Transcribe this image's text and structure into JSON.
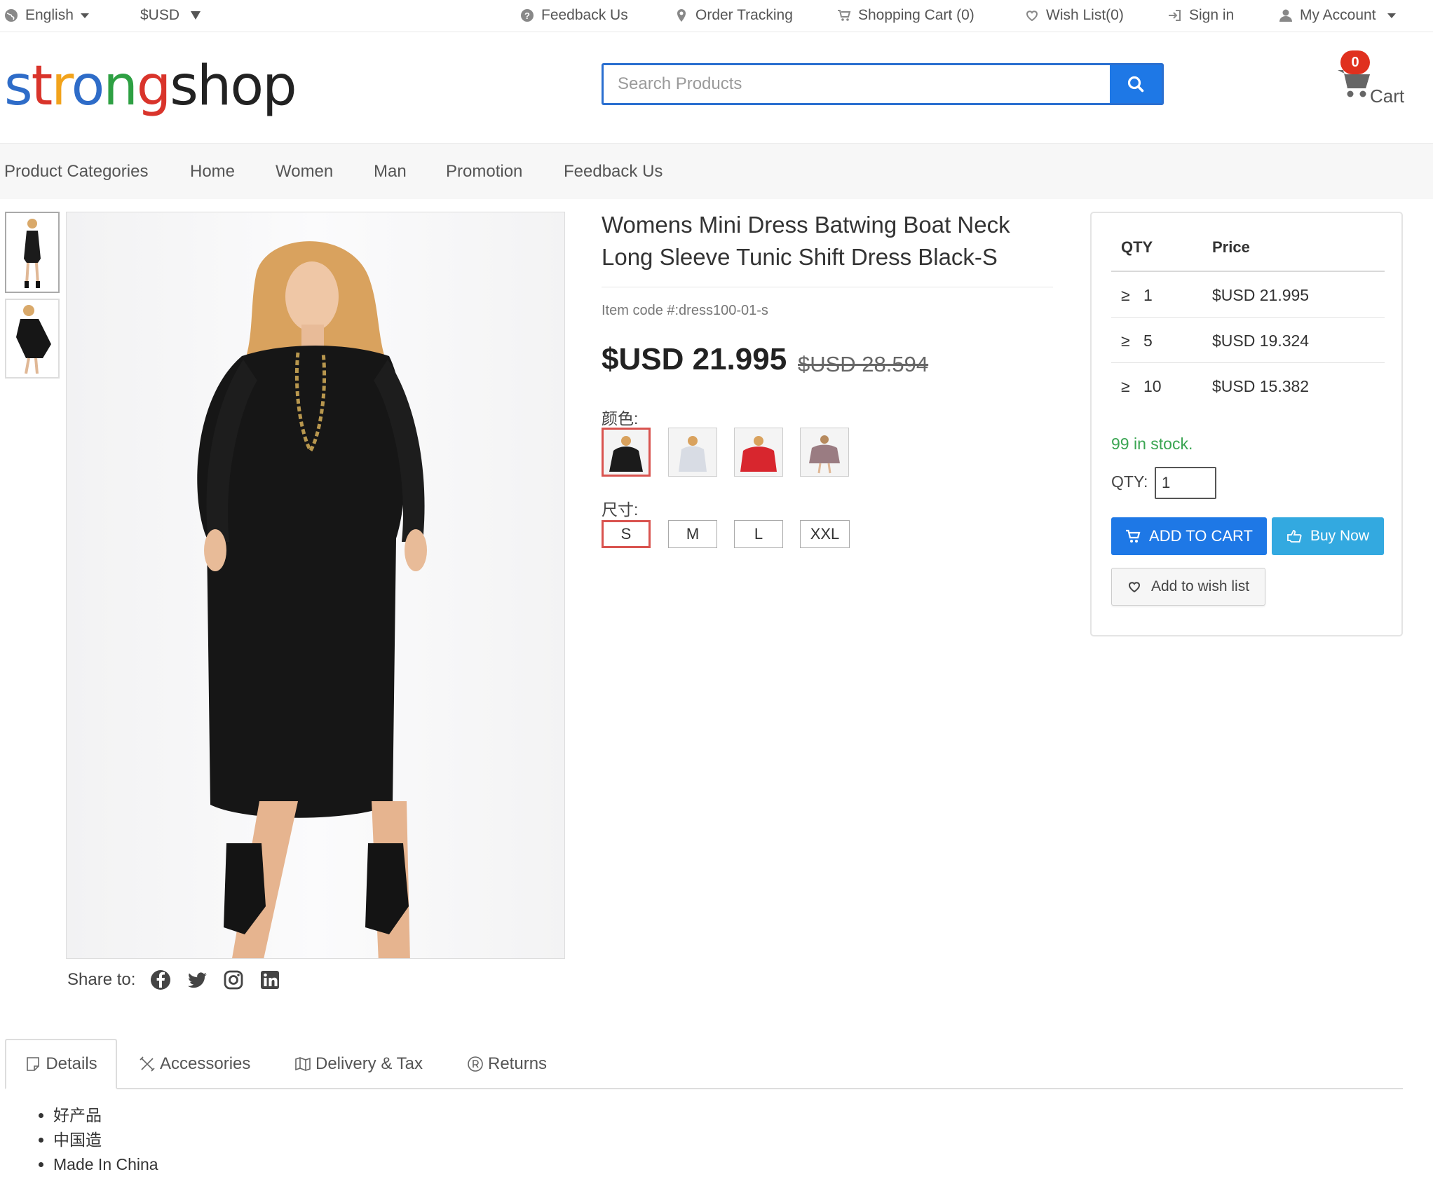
{
  "topbar": {
    "language": "English",
    "currency": "$USD",
    "feedback": "Feedback Us",
    "order_tracking": "Order Tracking",
    "shopping_cart": "Shopping Cart (0)",
    "wish_list": "Wish List(0)",
    "sign_in": "Sign in",
    "my_account": "My Account"
  },
  "header": {
    "logo_letters": [
      {
        "ch": "s",
        "color": "#2e6cc8"
      },
      {
        "ch": "t",
        "color": "#d9342b"
      },
      {
        "ch": "r",
        "color": "#f2a31b"
      },
      {
        "ch": "o",
        "color": "#2e6cc8"
      },
      {
        "ch": "n",
        "color": "#2ea043"
      },
      {
        "ch": "g",
        "color": "#d9342b"
      },
      {
        "ch": "s",
        "color": "#222222"
      },
      {
        "ch": "h",
        "color": "#222222"
      },
      {
        "ch": "o",
        "color": "#222222"
      },
      {
        "ch": "p",
        "color": "#222222"
      }
    ],
    "search_placeholder": "Search Products",
    "cart_count": "0",
    "cart_label": "Cart"
  },
  "nav": {
    "items": [
      "Product Categories",
      "Home",
      "Women",
      "Man",
      "Promotion",
      "Feedback Us"
    ]
  },
  "gallery": {
    "share_label": "Share to:",
    "share_icons": [
      "facebook-icon",
      "twitter-icon",
      "instagram-icon",
      "linkedin-icon"
    ]
  },
  "product": {
    "title": "Womens Mini Dress Batwing Boat Neck Long Sleeve Tunic Shift Dress Black-S",
    "item_code": "Item code #:dress100-01-s",
    "price": "$USD 21.995",
    "old_price": "$USD 28.594",
    "color_label": "颜色:",
    "colors": [
      {
        "name": "black",
        "hex": "#1b1b1b",
        "selected": true
      },
      {
        "name": "white",
        "hex": "#dcdfe6",
        "selected": false
      },
      {
        "name": "red",
        "hex": "#d8262e",
        "selected": false
      },
      {
        "name": "mauve",
        "hex": "#9a7c82",
        "selected": false
      }
    ],
    "size_label": "尺寸:",
    "sizes": [
      "S",
      "M",
      "L",
      "XXL"
    ],
    "selected_size": "S"
  },
  "panel": {
    "qty_header": "QTY",
    "price_header": "Price",
    "tiers": [
      {
        "symbol": "≥",
        "qty": "1",
        "price": "$USD 21.995"
      },
      {
        "symbol": "≥",
        "qty": "5",
        "price": "$USD 19.324"
      },
      {
        "symbol": "≥",
        "qty": "10",
        "price": "$USD 15.382"
      }
    ],
    "stock": "99 in stock.",
    "qty_label": "QTY:",
    "qty_value": "1",
    "add_to_cart": "ADD TO CART",
    "buy_now": "Buy Now",
    "wish": "Add to wish list"
  },
  "tabs": {
    "items": [
      "Details",
      "Accessories",
      "Delivery & Tax",
      "Returns"
    ],
    "active": "Details"
  },
  "details": [
    "好产品",
    "中国造",
    "Made In China"
  ]
}
